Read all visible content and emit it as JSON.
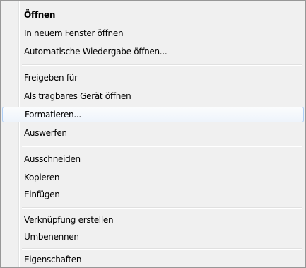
{
  "context_menu": {
    "items": [
      {
        "label": "Öffnen"
      },
      {
        "label": "In neuem Fenster öffnen"
      },
      {
        "label": "Automatische Wiedergabe öffnen..."
      },
      {
        "label": "Freigeben für"
      },
      {
        "label": "Als tragbares Gerät öffnen"
      },
      {
        "label": "Formatieren..."
      },
      {
        "label": "Auswerfen"
      },
      {
        "label": "Ausschneiden"
      },
      {
        "label": "Kopieren"
      },
      {
        "label": "Einfügen"
      },
      {
        "label": "Verknüpfung erstellen"
      },
      {
        "label": "Umbenennen"
      },
      {
        "label": "Eigenschaften"
      }
    ],
    "highlighted_item": "Formatieren...",
    "highlight_color": "#aecff7"
  }
}
